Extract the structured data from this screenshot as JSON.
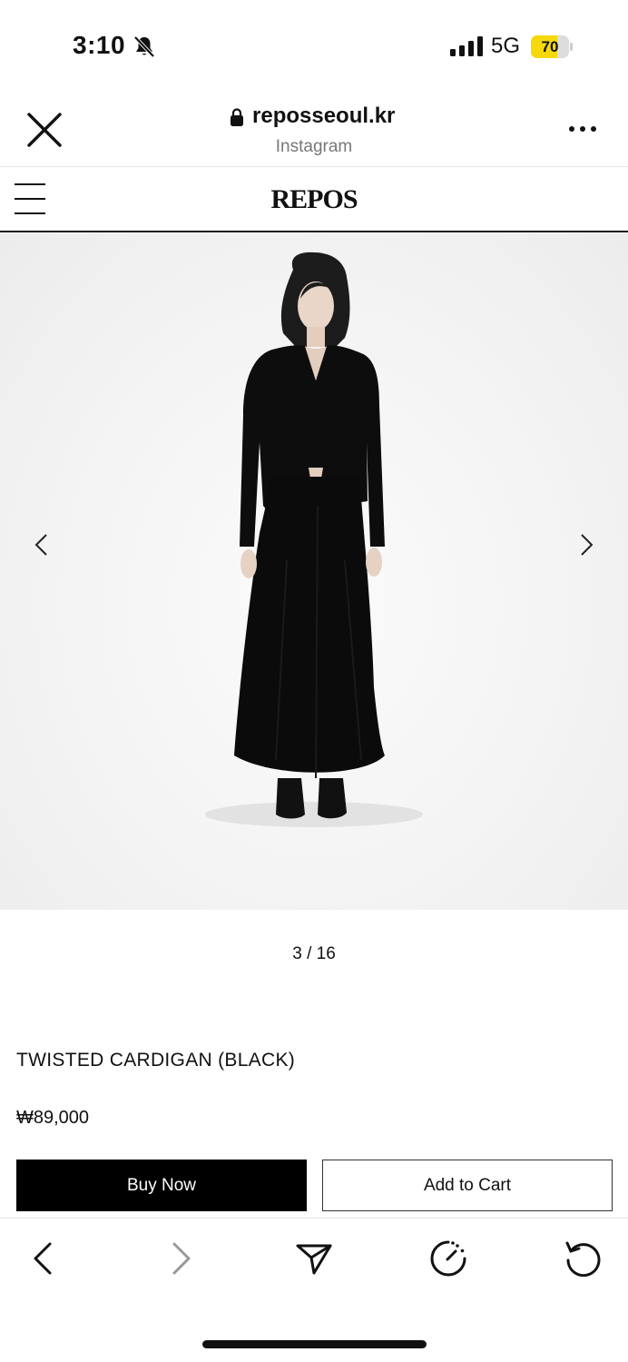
{
  "status_bar": {
    "time": "3:10",
    "network": "5G",
    "battery": "70",
    "battery_level_percent": 70,
    "battery_color": "#f5d90a"
  },
  "browser": {
    "url": "reposseoul.kr",
    "source": "Instagram"
  },
  "site": {
    "brand": "REPOS"
  },
  "gallery": {
    "counter": "3 / 16",
    "current": 3,
    "total": 16
  },
  "product": {
    "title": "TWISTED CARDIGAN (BLACK)",
    "price": "₩89,000",
    "buy_now_label": "Buy Now",
    "add_to_cart_label": "Add to Cart"
  },
  "icons": {
    "close": "close-icon",
    "lock": "lock-icon",
    "more": "more-icon",
    "menu": "hamburger-menu-icon",
    "prev": "chevron-left-icon",
    "next": "chevron-right-icon",
    "back": "back-arrow-icon",
    "forward": "forward-arrow-icon",
    "share": "send-icon",
    "speed": "gauge-icon",
    "reload": "reload-icon"
  }
}
